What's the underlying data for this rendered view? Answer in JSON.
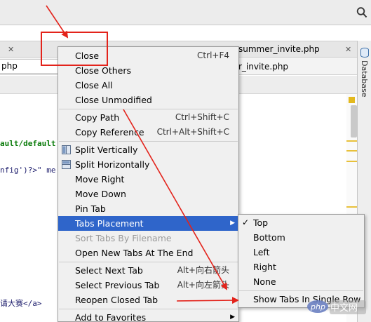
{
  "editor": {
    "tabs": [
      {
        "label": "php",
        "visible_partial": true
      },
      {
        "label": "summer_invite.php",
        "visible_partial": false
      }
    ],
    "row2_left": "php",
    "row2_right": "r_invite.php",
    "code_lines": [
      "ault/default",
      "nfig')?>\" me",
      "请大赛</a>"
    ],
    "side_panel_label": "Database"
  },
  "context_menu": {
    "items": [
      {
        "label": "Close",
        "shortcut": "Ctrl+F4",
        "enabled": true
      },
      {
        "label": "Close Others",
        "shortcut": "",
        "enabled": true
      },
      {
        "label": "Close All",
        "shortcut": "",
        "enabled": true
      },
      {
        "label": "Close Unmodified",
        "shortcut": "",
        "enabled": true
      },
      {
        "label": "Copy Path",
        "shortcut": "Ctrl+Shift+C",
        "enabled": true
      },
      {
        "label": "Copy Reference",
        "shortcut": "Ctrl+Alt+Shift+C",
        "enabled": true
      },
      {
        "label": "Split Vertically",
        "shortcut": "",
        "enabled": true,
        "icon": "split-vertical-icon"
      },
      {
        "label": "Split Horizontally",
        "shortcut": "",
        "enabled": true,
        "icon": "split-horizontal-icon"
      },
      {
        "label": "Move Right",
        "shortcut": "",
        "enabled": true
      },
      {
        "label": "Move Down",
        "shortcut": "",
        "enabled": true
      },
      {
        "label": "Pin Tab",
        "shortcut": "",
        "enabled": true
      },
      {
        "label": "Tabs Placement",
        "shortcut": "",
        "enabled": true,
        "highlighted": true,
        "submenu": true
      },
      {
        "label": "Sort Tabs By Filename",
        "shortcut": "",
        "enabled": false
      },
      {
        "label": "Open New Tabs At The End",
        "shortcut": "",
        "enabled": true
      },
      {
        "label": "Select Next Tab",
        "shortcut": "Alt+向右箭头",
        "enabled": true
      },
      {
        "label": "Select Previous Tab",
        "shortcut": "Alt+向左箭头",
        "enabled": true
      },
      {
        "label": "Reopen Closed Tab",
        "shortcut": "",
        "enabled": true
      },
      {
        "label": "Add to Favorites",
        "shortcut": "",
        "enabled": true,
        "submenu": true
      }
    ]
  },
  "submenu": {
    "items": [
      {
        "label": "Top",
        "checked": true
      },
      {
        "label": "Bottom",
        "checked": false
      },
      {
        "label": "Left",
        "checked": false
      },
      {
        "label": "Right",
        "checked": false
      },
      {
        "label": "None",
        "checked": false
      },
      {
        "label": "Show Tabs In Single Row",
        "checked": false
      }
    ],
    "check_glyph": "✓"
  },
  "watermark": {
    "text": "中文网",
    "logo": "php"
  },
  "colors": {
    "highlight": "#2f65ca",
    "annotation_red": "#e3231b",
    "menu_bg": "#f0f0f0",
    "disabled_text": "#9b9b9b"
  }
}
